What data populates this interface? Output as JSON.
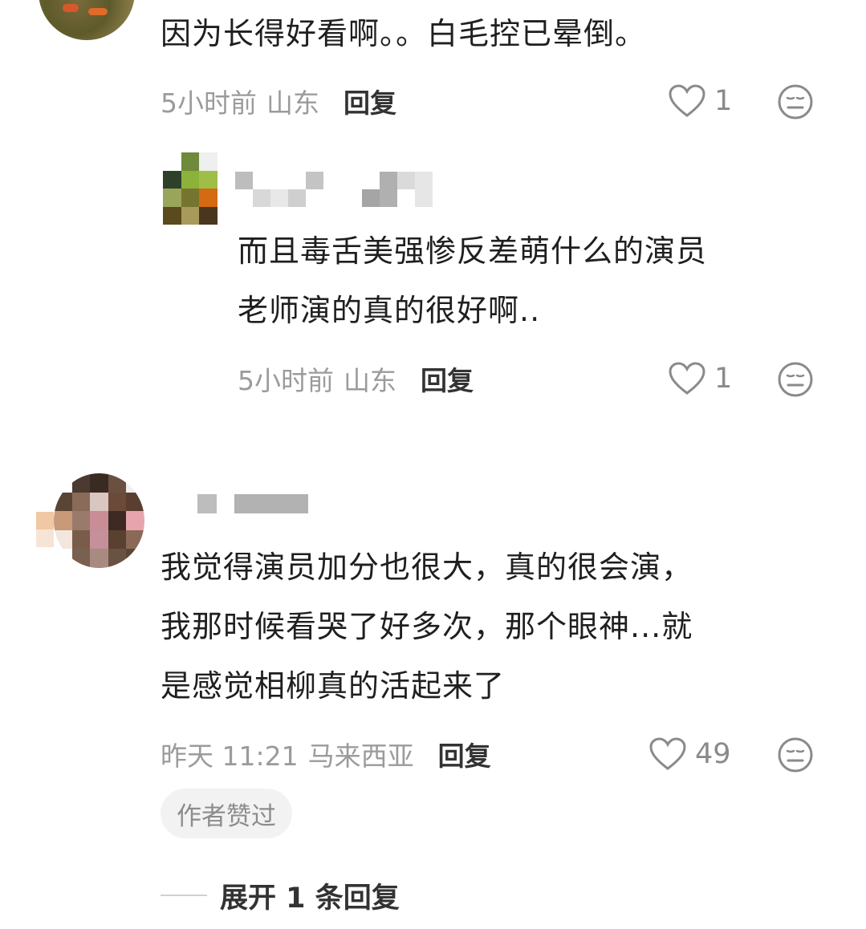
{
  "comments": [
    {
      "text": "因为长得好看啊。。白毛控已晕倒。",
      "time": "5小时前",
      "location": "山东",
      "reply_label": "回复",
      "likes": "1",
      "like_icon": "heart-outline-icon",
      "dislike_icon": "meh-face-icon"
    },
    {
      "text_line1": "而且毒舌美强惨反差萌什么的演员",
      "text_line2": "老师演的真的很好啊..",
      "time": "5小时前",
      "location": "山东",
      "reply_label": "回复",
      "likes": "1"
    },
    {
      "text_line1": "我觉得演员加分也很大，真的很会演，",
      "text_line2": "我那时候看哭了好多次，那个眼神...就",
      "text_line3": "是感觉相柳真的活起来了",
      "time": "昨天 11:21",
      "location": "马来西亚",
      "reply_label": "回复",
      "likes": "49",
      "badge": "作者赞过",
      "expand_label": "展开 1 条回复"
    }
  ],
  "colors": {
    "meta_gray": "#9b9b9b",
    "badge_bg": "#f2f2f2",
    "icon_gray": "#8a8a8a"
  }
}
